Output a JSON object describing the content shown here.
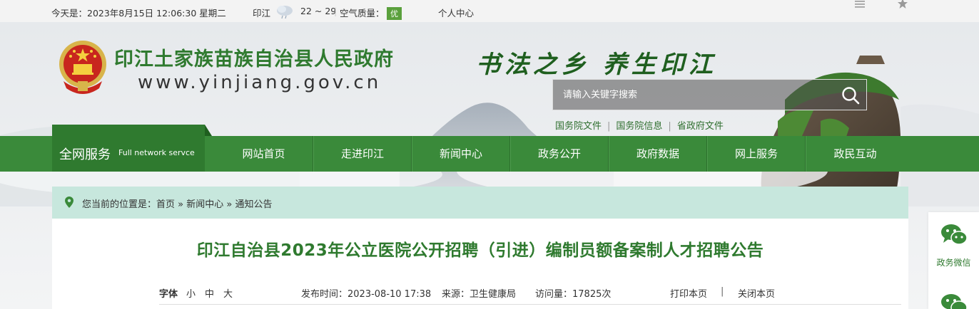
{
  "topbar": {
    "date": "今天是：2023年8月15日 12:06:30 星期二",
    "city": "印江",
    "temperature": "22 ~ 29",
    "aqi_label": "空气质量：",
    "aqi_value": "优",
    "personal_center": "个人中心"
  },
  "header": {
    "site_title": "印江土家族苗族自治县人民政府",
    "site_url": "www.yinjiang.gov.cn",
    "slogan": "书法之乡  养生印江",
    "search_placeholder": "请输入关键字搜索",
    "quick_links": [
      "国务院文件",
      "国务院信息",
      "省政府文件"
    ]
  },
  "nav": {
    "service_cn": "全网服务",
    "service_en": "Full network servce",
    "items": [
      "网站首页",
      "走进印江",
      "新闻中心",
      "政务公开",
      "政府数据",
      "网上服务",
      "政民互动"
    ]
  },
  "breadcrumb": {
    "prefix": "您当前的位置是：",
    "crumbs": [
      "首页",
      "新闻中心",
      "通知公告"
    ],
    "separator": " » "
  },
  "article": {
    "title": "印江自治县2023年公立医院公开招聘（引进）编制员额备案制人才招聘公告",
    "font_label": "字体",
    "font_small": "小",
    "font_medium": "中",
    "font_large": "大",
    "publish_time": "发布时间：2023-08-10 17:38",
    "source": "来源：卫生健康局",
    "views": "访问量：17825次",
    "print": "打印本页",
    "close": "关闭本页",
    "sep": "|"
  },
  "side": {
    "wechat_label": "政务微信"
  },
  "colors": {
    "brand_green": "#3a8a3a",
    "dark_green": "#2f7a2f",
    "breadcrumb_bg": "#c7e7dd"
  }
}
